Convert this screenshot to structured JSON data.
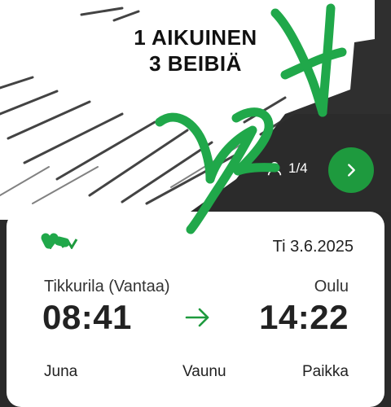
{
  "overlay_title": {
    "line1": "1 AIKUINEN",
    "line2": "3 BEIBIÄ"
  },
  "ticket_progress": {
    "text": "1/4",
    "icon": "person-icon"
  },
  "next_button": {
    "icon": "chevron-right-icon",
    "color": "#1e9a3e"
  },
  "ticket": {
    "date": "Ti 3.6.2025",
    "from_station": "Tikkurila (Vantaa)",
    "to_station": "Oulu",
    "departure_time": "08:41",
    "arrival_time": "14:22",
    "arrow_icon": "arrow-right-icon",
    "arrow_color": "#1e9a3e",
    "labels": {
      "train": "Juna",
      "car": "Vaunu",
      "seat": "Paikka"
    }
  },
  "colors": {
    "background": "#2a2a2a",
    "card": "#ffffff",
    "accent": "#1e9a3e",
    "handwriting": "#20a84a"
  }
}
